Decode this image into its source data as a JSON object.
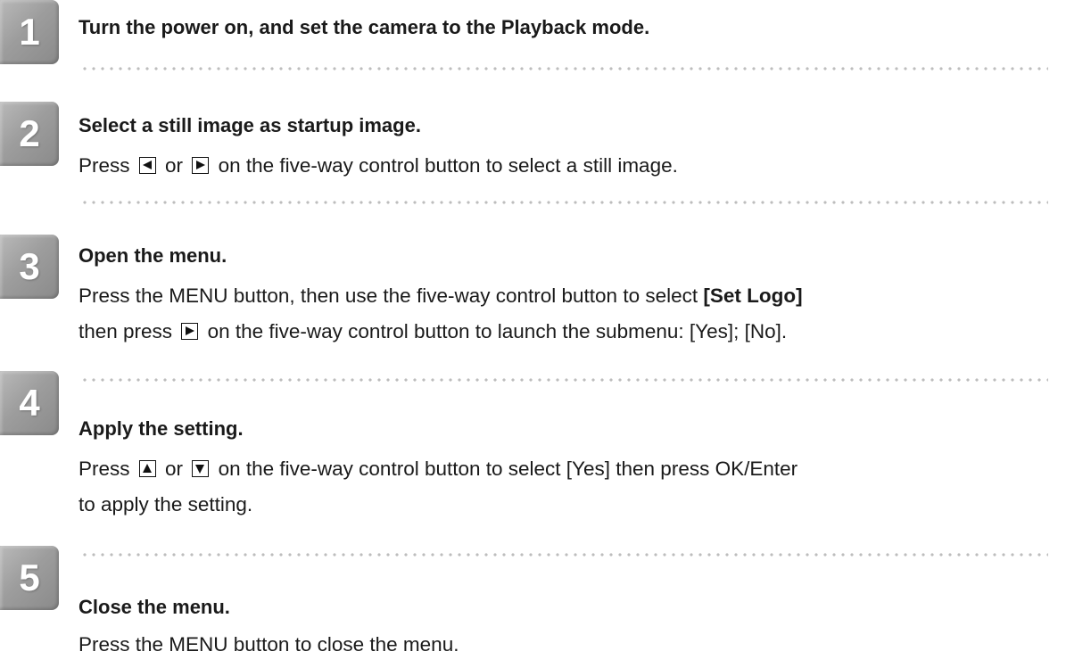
{
  "colors": {
    "badge_gray": "#a3a3a3",
    "dot_gray": "#bdbdbd",
    "text": "#1a1a1a"
  },
  "steps": [
    {
      "number": "1",
      "heading": "Turn the power on, and set the camera to the Playback mode."
    },
    {
      "number": "2",
      "heading": "Select a still image as startup image.",
      "lines": [
        {
          "before": "Press",
          "key1_icon": "left-arrow-key-icon",
          "mid": "or",
          "key2_icon": "right-arrow-key-icon",
          "after": "on the five-way control button to select a still image."
        }
      ]
    },
    {
      "number": "3",
      "heading": "Open the menu.",
      "lines": [
        {
          "text": "Press the MENU button, then use the five-way control button to select",
          "bold": "[Set Logo]"
        },
        {
          "before": "then press",
          "key_icon": "right-arrow-key-icon",
          "after": "on the five-way control button to launch the submenu: [Yes]; [No]."
        }
      ]
    },
    {
      "number": "4",
      "heading": "Apply the setting.",
      "lines": [
        {
          "before": "Press",
          "key1_icon": "up-arrow-key-icon",
          "mid": "or",
          "key2_icon": "down-arrow-key-icon",
          "after": "on the five-way control button to select [Yes] then press OK/Enter"
        },
        {
          "text": "to apply the setting."
        }
      ]
    },
    {
      "number": "5",
      "heading": "Close the menu.",
      "lines": [
        {
          "text": "Press the MENU button to close the menu."
        }
      ]
    }
  ]
}
